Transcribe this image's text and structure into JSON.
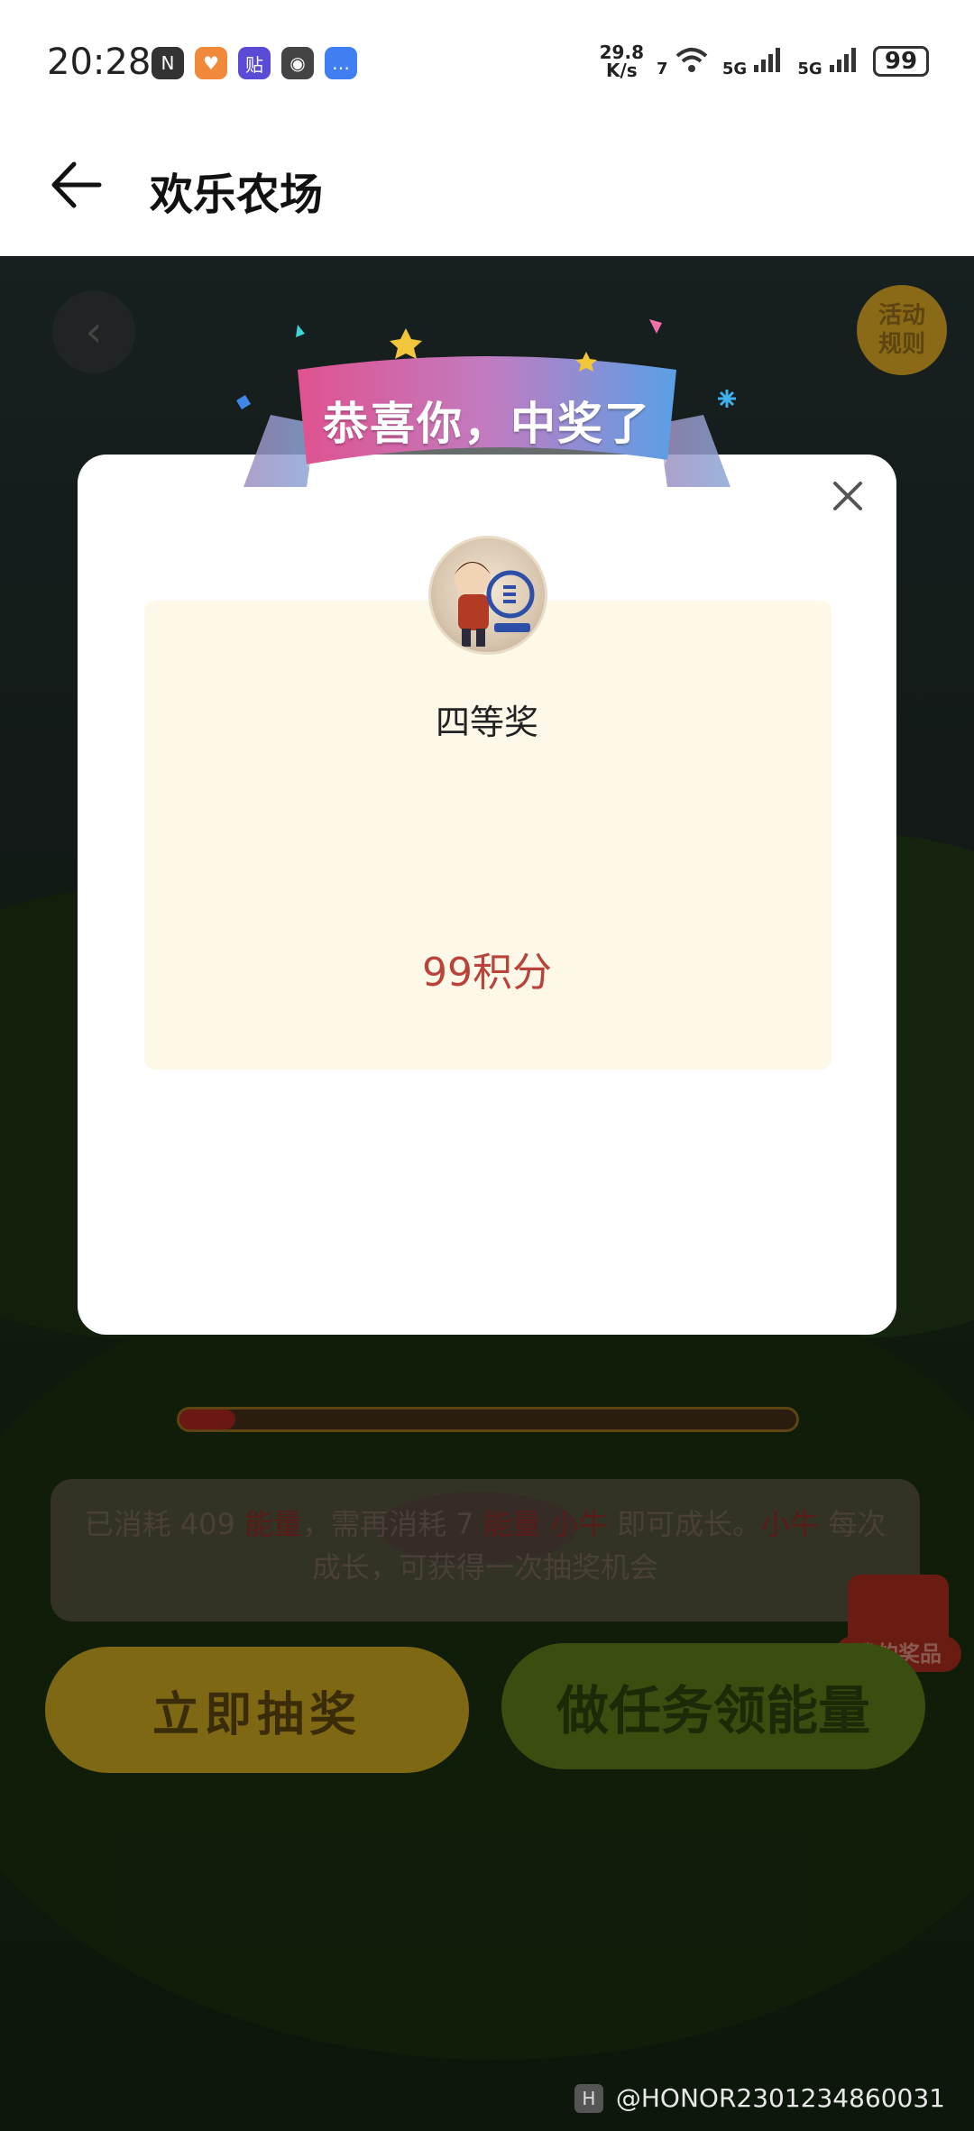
{
  "status_bar": {
    "time": "20:28",
    "net_speed_top": "29.8",
    "net_speed_bottom": "K/s",
    "wifi_label": "7",
    "sig1_label": "5G",
    "sig2_label": "5G",
    "battery": "99",
    "app_icons": [
      "nfc-icon",
      "taobao-icon",
      "tieba-icon",
      "wechat-icon",
      "messages-icon"
    ]
  },
  "header": {
    "title": "欢乐农场"
  },
  "scene": {
    "rules_label": "活动规则",
    "progress_fraction": 0.09,
    "info_parts": {
      "p1": "已消耗 409 ",
      "p2": "能量",
      "p3": "，需再消耗 7 ",
      "p4": "能量",
      "p5": " ",
      "p6": "小牛",
      "p7": " 即可成长。",
      "p8": "小牛",
      "p9": " 每次成长，可获得一次抽奖机会"
    },
    "draw_button": "立即抽奖",
    "task_button": "做任务领能量",
    "my_prize_label": "我的奖品"
  },
  "modal": {
    "banner_text": "恭喜你，中奖了",
    "prize_name": "四等奖",
    "prize_value": "99积分"
  },
  "watermark": {
    "text": "@HONOR2301234860031"
  },
  "colors": {
    "prize_value": "#b9433a",
    "prize_panel": "#fdf8e7",
    "ribbon_pink": "#e0528f",
    "ribbon_blue": "#5aa0e6"
  }
}
